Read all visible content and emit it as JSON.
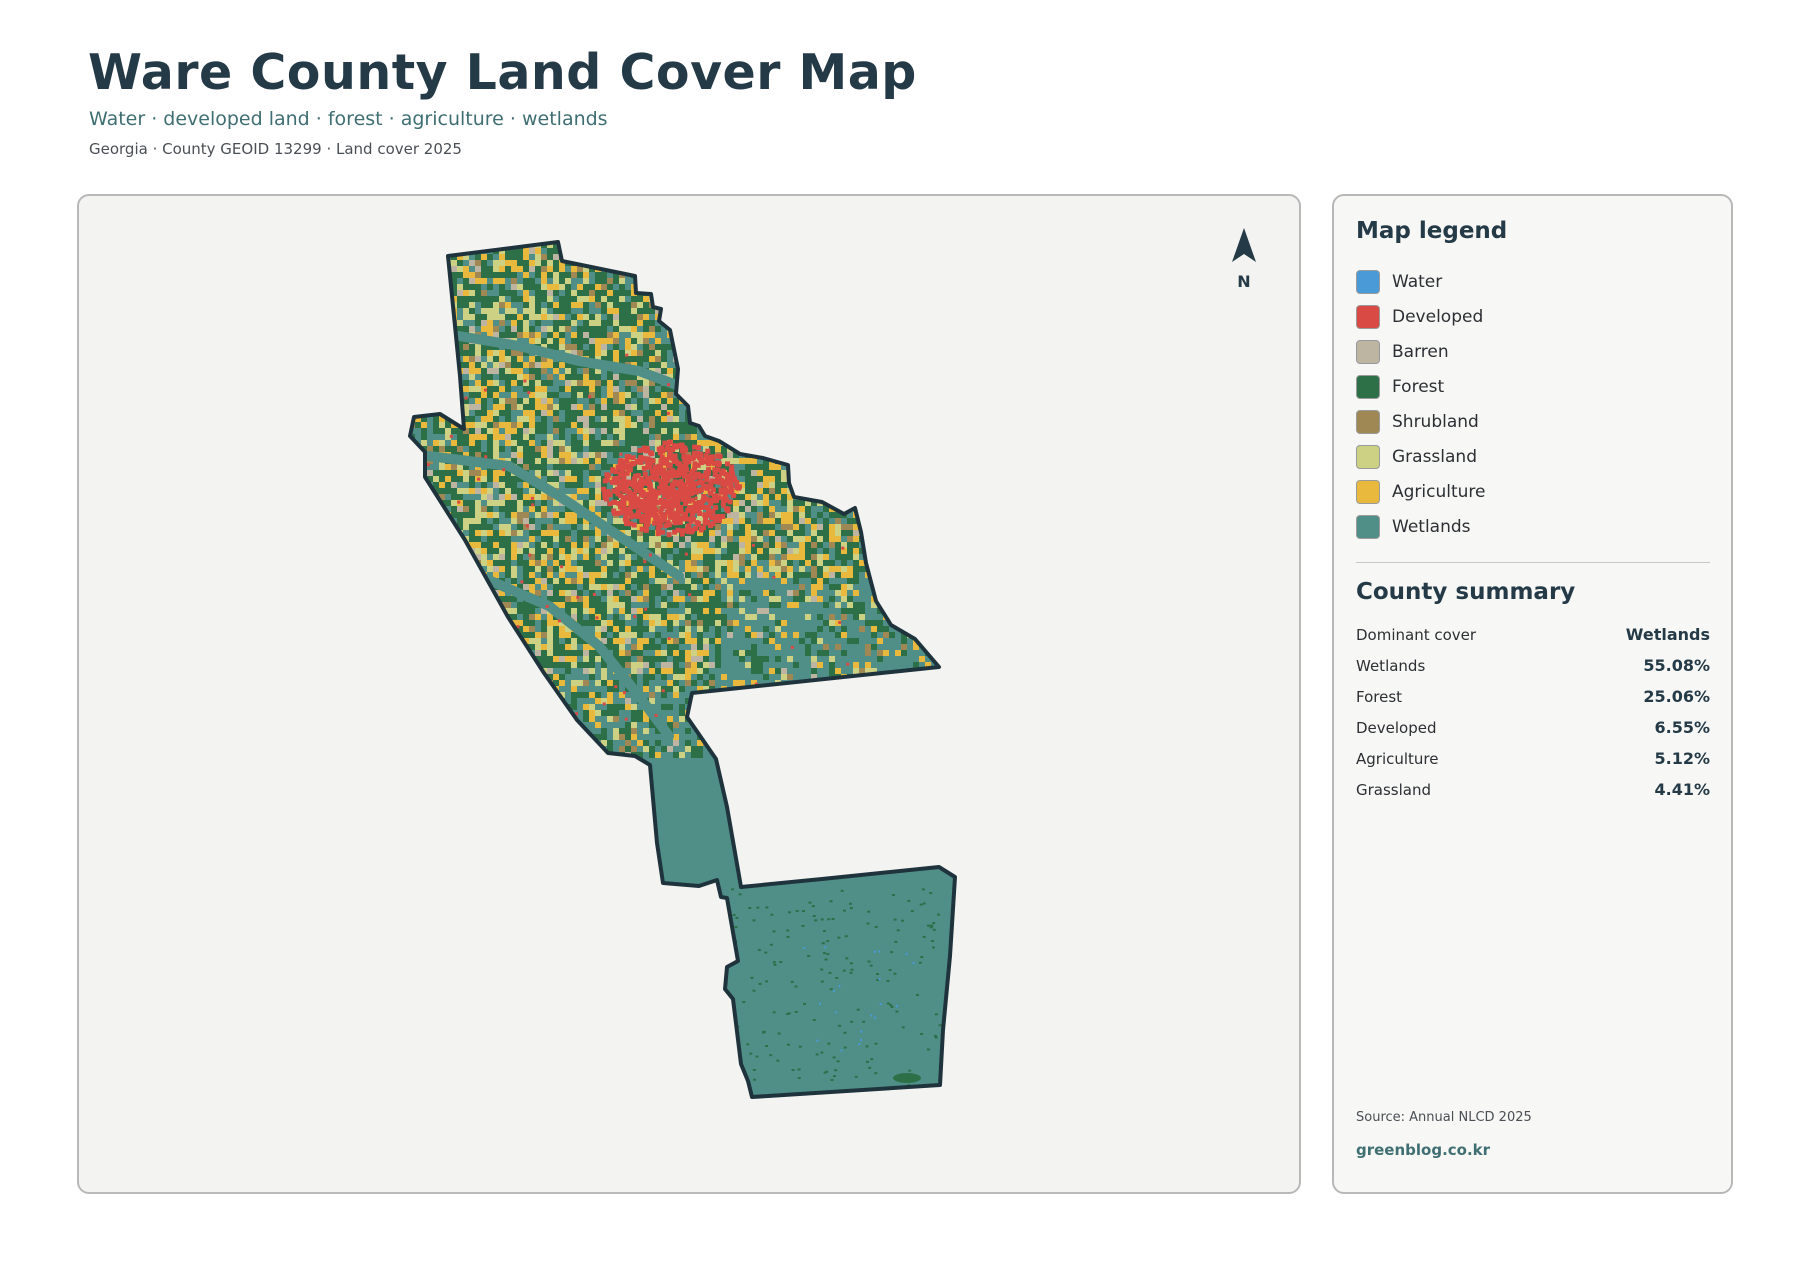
{
  "header": {
    "title": "Ware County Land Cover Map",
    "subtitle": "Water · developed land · forest · agriculture · wetlands",
    "meta": "Georgia · County GEOID 13299 · Land cover 2025"
  },
  "map": {
    "north_label": "N",
    "colors": {
      "water": "#4a9ad8",
      "developed": "#d94a45",
      "barren": "#bdb5a1",
      "forest": "#2d7048",
      "shrubland": "#a08855",
      "grassland": "#ccd183",
      "agriculture": "#e8b93c",
      "wetlands": "#4f8f88",
      "outline": "#1f333d"
    }
  },
  "legend": {
    "heading": "Map legend",
    "items": [
      {
        "label": "Water",
        "color": "#4a9ad8"
      },
      {
        "label": "Developed",
        "color": "#d94a45"
      },
      {
        "label": "Barren",
        "color": "#bdb5a1"
      },
      {
        "label": "Forest",
        "color": "#2d7048"
      },
      {
        "label": "Shrubland",
        "color": "#a08855"
      },
      {
        "label": "Grassland",
        "color": "#ccd183"
      },
      {
        "label": "Agriculture",
        "color": "#e8b93c"
      },
      {
        "label": "Wetlands",
        "color": "#4f8f88"
      }
    ]
  },
  "summary": {
    "heading": "County summary",
    "rows": [
      {
        "key": "Dominant cover",
        "value": "Wetlands"
      },
      {
        "key": "Wetlands",
        "value": "55.08%"
      },
      {
        "key": "Forest",
        "value": "25.06%"
      },
      {
        "key": "Developed",
        "value": "6.55%"
      },
      {
        "key": "Agriculture",
        "value": "5.12%"
      },
      {
        "key": "Grassland",
        "value": "4.41%"
      }
    ]
  },
  "footer": {
    "source": "Source: Annual NLCD 2025",
    "site": "greenblog.co.kr"
  }
}
